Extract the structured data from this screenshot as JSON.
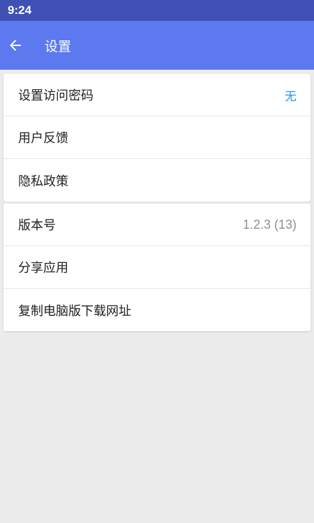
{
  "status_bar": {
    "time": "9:24"
  },
  "app_bar": {
    "title": "设置",
    "back_icon": "arrow-left-icon"
  },
  "colors": {
    "status_bar": "#3f51b5",
    "app_bar": "#5c79f0",
    "accent_value": "#2196f3"
  },
  "section_one": {
    "items": [
      {
        "label": "设置访问密码",
        "value": "无"
      },
      {
        "label": "用户反馈"
      },
      {
        "label": "隐私政策"
      }
    ]
  },
  "section_two": {
    "items": [
      {
        "label": "版本号",
        "value": "1.2.3 (13)"
      },
      {
        "label": "分享应用"
      },
      {
        "label": "复制电脑版下载网址"
      }
    ]
  }
}
